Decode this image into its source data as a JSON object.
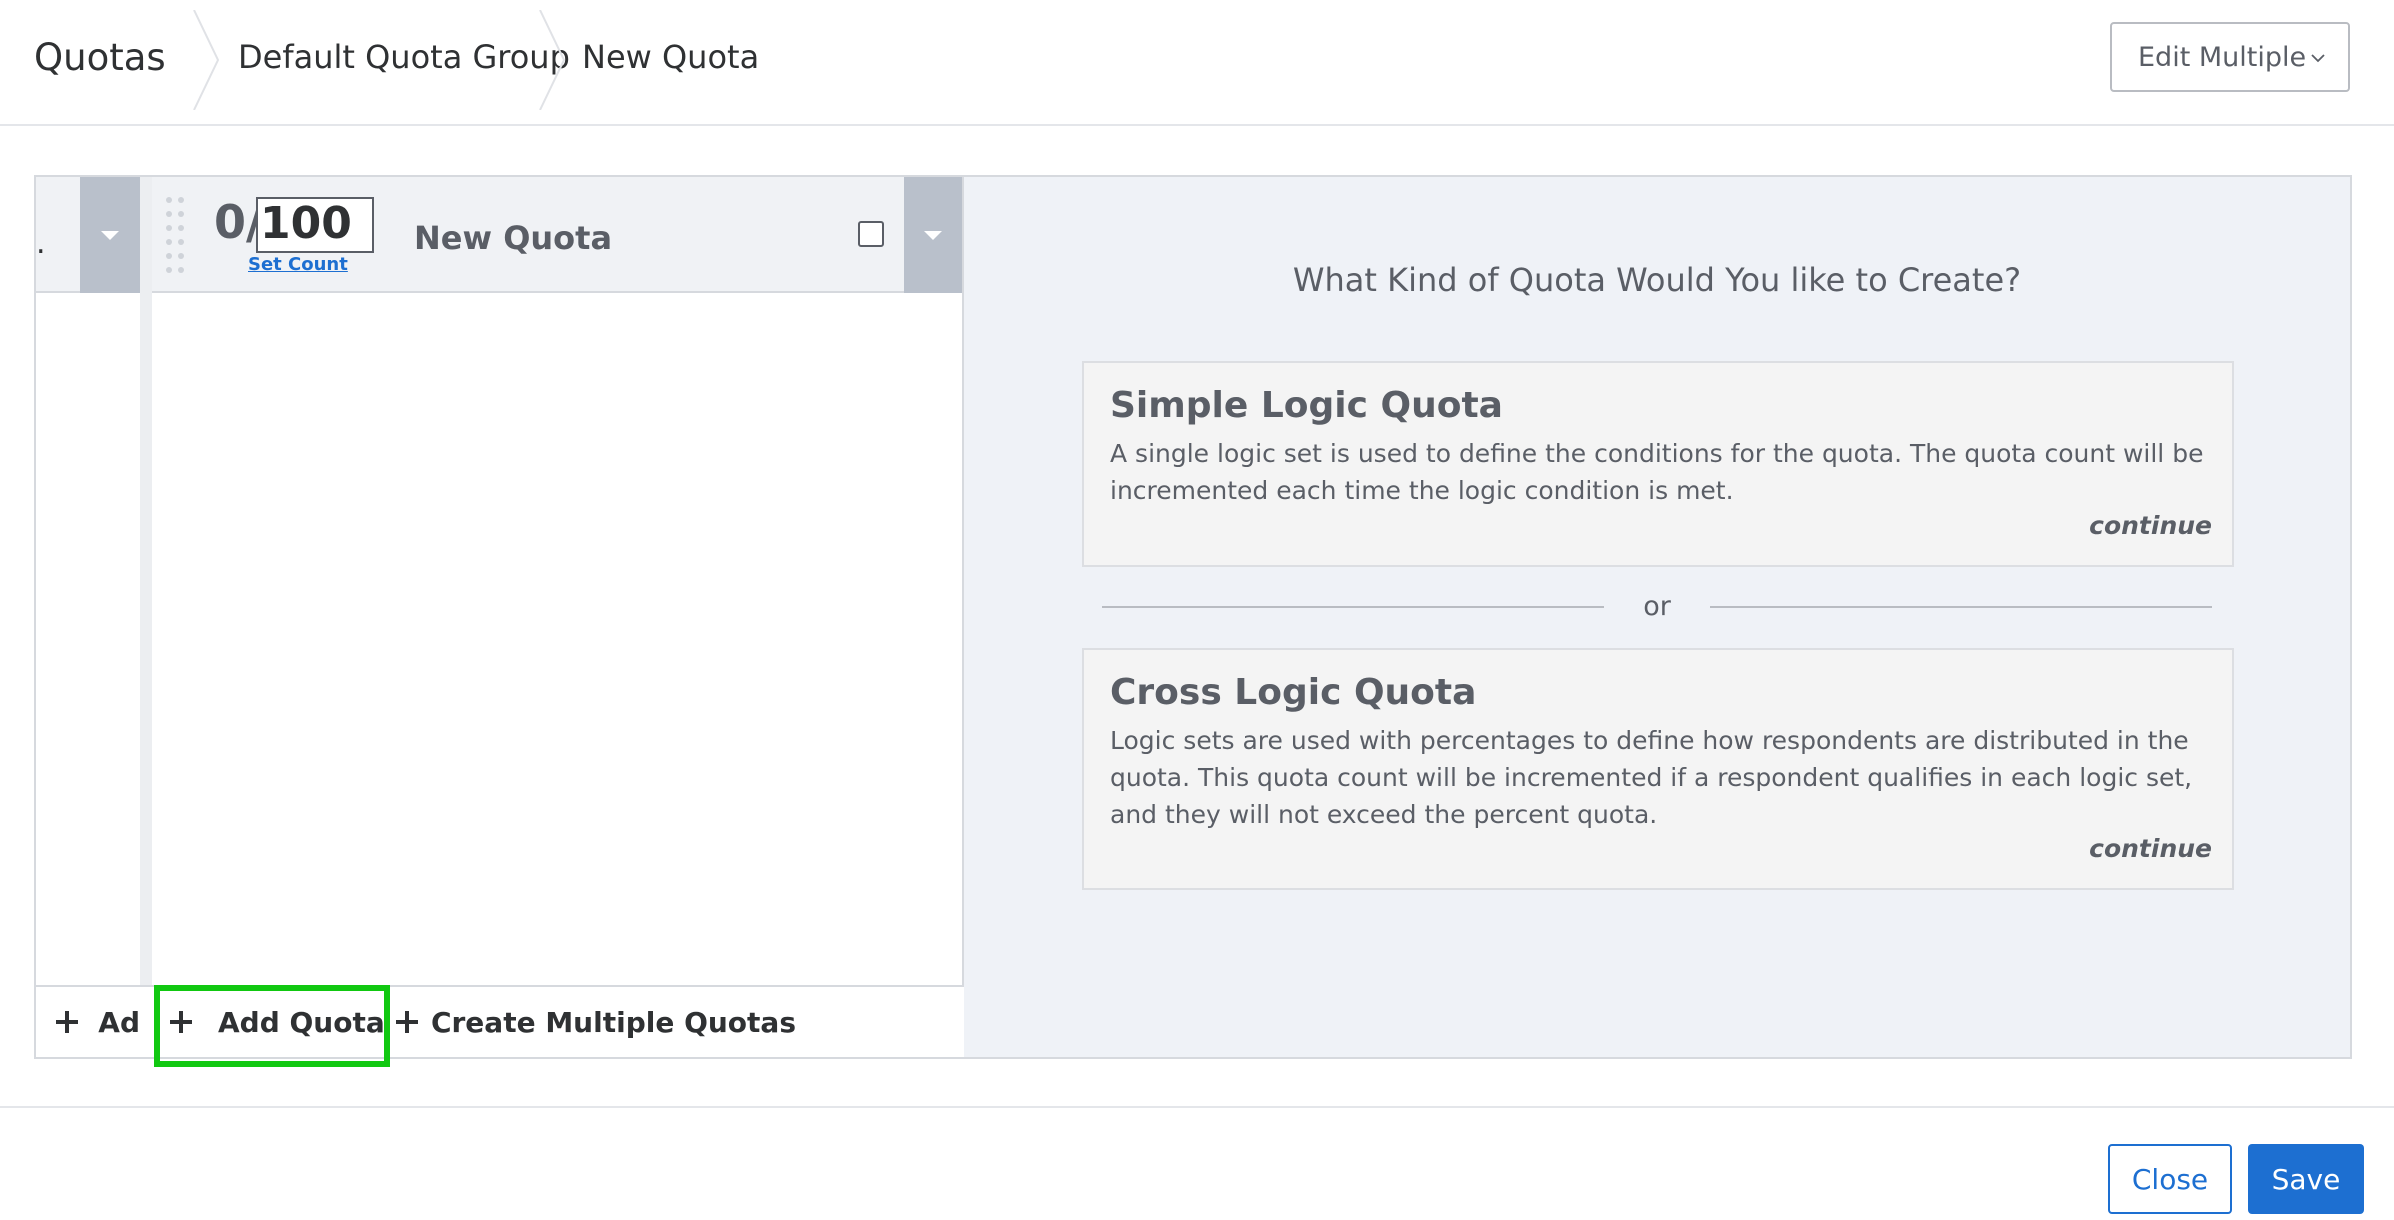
{
  "breadcrumb": {
    "root": "Quotas",
    "group": "Default Quota Group",
    "current": "New Quota"
  },
  "header": {
    "edit_multiple_label": "Edit Multiple"
  },
  "stub_column": {
    "truncated_text": ".",
    "footer_label": "Ad"
  },
  "quota_card": {
    "count_prefix": "0/",
    "count_value": "100",
    "set_count_label": "Set Count",
    "name": "New Quota"
  },
  "left_footer": {
    "add_quota_label": "Add Quota",
    "create_multiple_label": "Create Multiple Quotas"
  },
  "right_panel": {
    "prompt": "What Kind of Quota Would You like to Create?",
    "options": [
      {
        "title": "Simple Logic Quota",
        "description": "A single logic set is used to define the conditions for the quota. The quota count will be incremented each time the logic condition is met.",
        "action": "continue"
      },
      {
        "title": "Cross Logic Quota",
        "description": "Logic sets are used with percentages to define how respondents are distributed in the quota. This quota count will be incremented if a respondent qualifies in each logic set, and they will not exceed the percent quota.",
        "action": "continue"
      }
    ],
    "separator": "or"
  },
  "footer": {
    "close_label": "Close",
    "save_label": "Save"
  },
  "colors": {
    "accent": "#1d6fd1",
    "highlight": "#11c811",
    "dropdown_bg": "#b9c0cb",
    "right_bg": "#eff2f7"
  },
  "icons": [
    "chevron-down-icon",
    "breadcrumb-separator-icon",
    "drag-handle-icon",
    "plus-icon",
    "dropdown-caret-icon"
  ]
}
